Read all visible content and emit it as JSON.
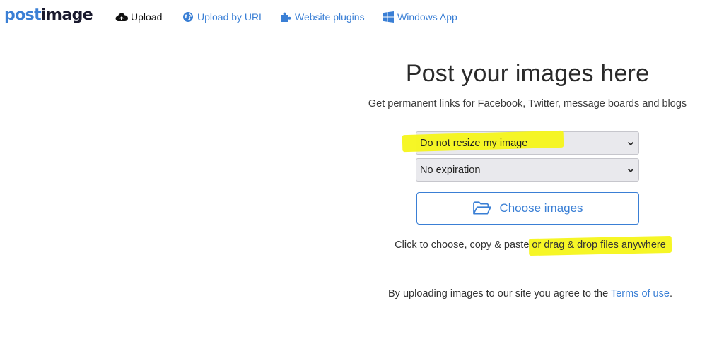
{
  "logo": {
    "part1": "post",
    "part2": "image"
  },
  "nav": {
    "upload": "Upload",
    "upload_by_url": "Upload by URL",
    "website_plugins": "Website plugins",
    "windows_app": "Windows App"
  },
  "main": {
    "title": "Post your images here",
    "subtitle": "Get permanent links for Facebook, Twitter, message boards and blogs",
    "resize_select": {
      "value": "Do not resize my image"
    },
    "expiration_select": {
      "value": "No expiration"
    },
    "choose_button": "Choose images",
    "hint_plain": "Click to choose, copy & paste ",
    "hint_highlighted": "or drag & drop files anywhere",
    "terms_prefix": "By uploading images to our site you agree to the ",
    "terms_link": "Terms of use",
    "terms_suffix": "."
  },
  "colors": {
    "accent": "#3a7fd5",
    "highlight": "#f5f51a",
    "select_bg": "#e9e9ed"
  },
  "icons": {
    "upload": "cloud-upload-icon",
    "url": "globe-icon",
    "plugins": "puzzle-icon",
    "windows": "windows-icon",
    "choose": "folder-open-icon",
    "select": "chevron-down-icon"
  }
}
